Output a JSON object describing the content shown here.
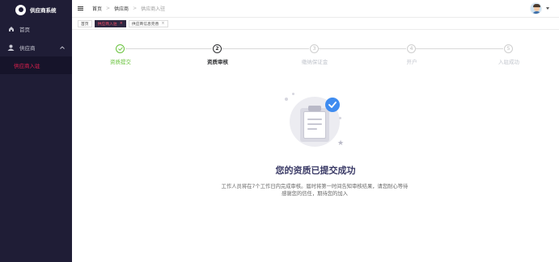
{
  "app": {
    "title": "供应商系统"
  },
  "sidebar": {
    "items": [
      {
        "label": "首页",
        "icon": "home-icon"
      },
      {
        "label": "供应商",
        "icon": "supplier-icon",
        "expanded": true,
        "children": [
          {
            "label": "供应商入驻",
            "active": true
          }
        ]
      }
    ]
  },
  "header": {
    "breadcrumb": [
      "首页",
      "供应商",
      "供应商入驻"
    ]
  },
  "tags": [
    {
      "label": "首页",
      "active": false,
      "closable": false
    },
    {
      "label": "供应商入驻",
      "active": true,
      "closable": true
    },
    {
      "label": "供应商信息完善",
      "active": false,
      "closable": true
    }
  ],
  "steps": [
    {
      "index": "1",
      "title": "资质提交",
      "status": "finish"
    },
    {
      "index": "2",
      "title": "资质审核",
      "status": "process"
    },
    {
      "index": "3",
      "title": "缴纳保证金",
      "status": "wait"
    },
    {
      "index": "4",
      "title": "开户",
      "status": "wait"
    },
    {
      "index": "5",
      "title": "入驻成功",
      "status": "wait"
    }
  ],
  "result": {
    "title": "您的资质已提交成功",
    "desc_line1": "工作人员将在7个工作日内完成审核。届时将第一时间告知审核结果，请您耐心等待",
    "desc_line2": "感谢您的信任，期待您的加入"
  },
  "colors": {
    "sidebar_bg": "#1f1d36",
    "accent": "#e0204e",
    "success": "#67c23a",
    "badge_blue": "#3f8cf0",
    "title_color": "#3a3a66"
  }
}
